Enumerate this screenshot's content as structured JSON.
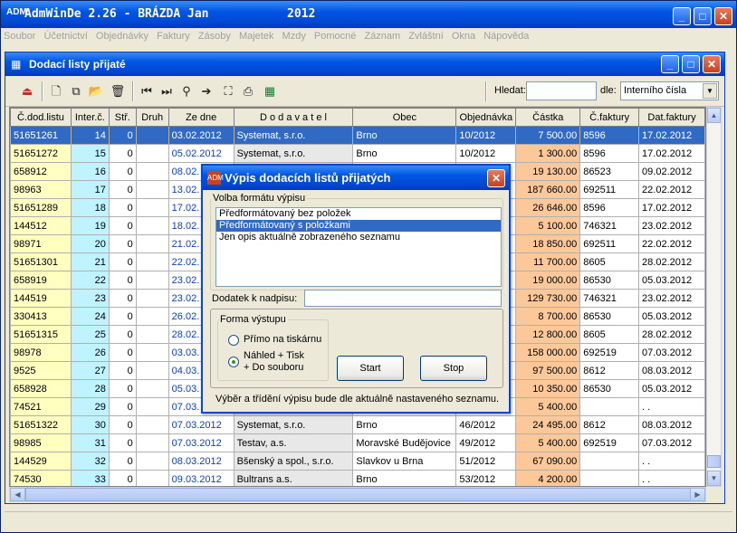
{
  "app": {
    "title": "AdmWinDe 2.26 - BRÁZDA Jan",
    "year": "2012",
    "logo": "ADM",
    "min": "_",
    "max": "□",
    "close": "✕"
  },
  "menu": [
    "Soubor",
    "Účetnictví",
    "Objednávky",
    "Faktury",
    "Zásoby",
    "Majetek",
    "Mzdy",
    "Pomocné",
    "Záznam",
    "Zvláštní",
    "Okna",
    "Nápověda"
  ],
  "child": {
    "title": "Dodací listy přijaté",
    "icon": "▦"
  },
  "toolbar": {
    "hledat_label": "Hledat:",
    "hledat_value": "",
    "dle_label": "dle:",
    "dle_value": "Interního čísla",
    "icons": [
      "exit-icon",
      "new-icon",
      "copy-icon",
      "open-icon",
      "delete-icon",
      "first-icon",
      "last-icon",
      "search-icon",
      "next-icon",
      "select-icon",
      "print-icon",
      "excel-icon"
    ]
  },
  "table": {
    "headers": [
      "Č.dod.listu",
      "Inter.č.",
      "Stř.",
      "Druh",
      "Ze dne",
      "D o d a v a t e l",
      "Obec",
      "Objednávka",
      "Částka",
      "Č.faktury",
      "Dat.faktury"
    ],
    "rows": [
      [
        "51651261",
        "14",
        "0",
        "",
        "03.02.2012",
        "Systemat, s.r.o.",
        "Brno",
        "10/2012",
        "7 500.00",
        "8596",
        "17.02.2012"
      ],
      [
        "51651272",
        "15",
        "0",
        "",
        "05.02.2012",
        "Systemat, s.r.o.",
        "Brno",
        "10/2012",
        "1 300.00",
        "8596",
        "17.02.2012"
      ],
      [
        "658912",
        "16",
        "0",
        "",
        "08.02.",
        "",
        "",
        "",
        "19 130.00",
        "86523",
        "09.02.2012"
      ],
      [
        "98963",
        "17",
        "0",
        "",
        "13.02.",
        "",
        "",
        "",
        "187 660.00",
        "692511",
        "22.02.2012"
      ],
      [
        "51651289",
        "18",
        "0",
        "",
        "17.02.",
        "",
        "",
        "",
        "26 646.00",
        "8596",
        "17.02.2012"
      ],
      [
        "144512",
        "19",
        "0",
        "",
        "18.02.",
        "",
        "",
        "",
        "5 100.00",
        "746321",
        "23.02.2012"
      ],
      [
        "98971",
        "20",
        "0",
        "",
        "21.02.",
        "",
        "",
        "",
        "18 850.00",
        "692511",
        "22.02.2012"
      ],
      [
        "51651301",
        "21",
        "0",
        "",
        "22.02.",
        "",
        "",
        "",
        "11 700.00",
        "8605",
        "28.02.2012"
      ],
      [
        "658919",
        "22",
        "0",
        "",
        "23.02.",
        "",
        "",
        "",
        "19 000.00",
        "86530",
        "05.03.2012"
      ],
      [
        "144519",
        "23",
        "0",
        "",
        "23.02.",
        "",
        "",
        "",
        "129 730.00",
        "746321",
        "23.02.2012"
      ],
      [
        "330413",
        "24",
        "0",
        "",
        "26.02.",
        "",
        "",
        "",
        "8 700.00",
        "86530",
        "05.03.2012"
      ],
      [
        "51651315",
        "25",
        "0",
        "",
        "28.02.",
        "",
        "",
        "",
        "12 800.00",
        "8605",
        "28.02.2012"
      ],
      [
        "98978",
        "26",
        "0",
        "",
        "03.03.",
        "",
        "",
        "",
        "158 000.00",
        "692519",
        "07.03.2012"
      ],
      [
        "9525",
        "27",
        "0",
        "",
        "04.03.",
        "",
        "",
        "",
        "97 500.00",
        "8612",
        "08.03.2012"
      ],
      [
        "658928",
        "28",
        "0",
        "",
        "05.03.",
        "",
        "",
        "",
        "10 350.00",
        "86530",
        "05.03.2012"
      ],
      [
        "74521",
        "29",
        "0",
        "",
        "07.03.",
        "",
        "",
        "",
        "5 400.00",
        "",
        ". ."
      ],
      [
        "51651322",
        "30",
        "0",
        "",
        "07.03.2012",
        "Systemat, s.r.o.",
        "Brno",
        "46/2012",
        "24 495.00",
        "8612",
        "08.03.2012"
      ],
      [
        "98985",
        "31",
        "0",
        "",
        "07.03.2012",
        "Testav, a.s.",
        "Moravské Budějovice",
        "49/2012",
        "5 400.00",
        "692519",
        "07.03.2012"
      ],
      [
        "144529",
        "32",
        "0",
        "",
        "08.03.2012",
        "Bšenský a spol., s.r.o.",
        "Slavkov u Brna",
        "51/2012",
        "67 090.00",
        "",
        ". ."
      ],
      [
        "74530",
        "33",
        "0",
        "",
        "09.03.2012",
        "Bultrans a.s.",
        "Brno",
        "53/2012",
        "4 200.00",
        "",
        ". ."
      ]
    ]
  },
  "dialog": {
    "title": "Výpis dodacích listů přijatých",
    "icon": "ADM",
    "close": "✕",
    "format_legend": "Volba formátu výpisu",
    "format_options": [
      "Předformátovaný bez položek",
      "Předformátovaný s položkami",
      "Jen opis aktuálně zobrazeného seznamu"
    ],
    "selected_format": 1,
    "dodatek_label": "Dodatek k nadpisu:",
    "dodatek_value": "",
    "output_legend": "Forma výstupu",
    "output_option1": "Přímo na tiskárnu",
    "output_option2_line1": "Náhled + Tisk",
    "output_option2_line2": "+ Do souboru",
    "start_label": "Start",
    "stop_label": "Stop",
    "note": "Výběr a třídění výpisu bude dle aktuálně nastaveného seznamu."
  }
}
